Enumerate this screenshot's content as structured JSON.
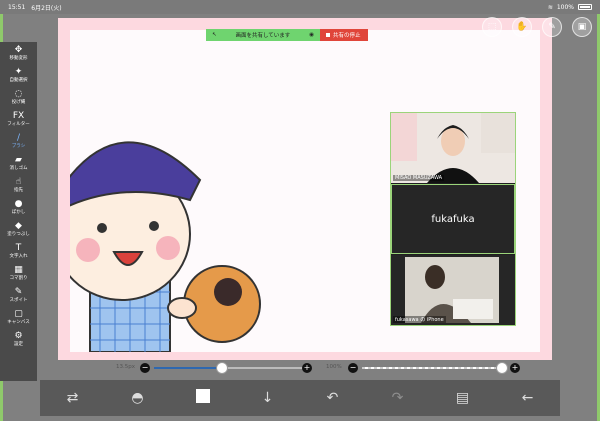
{
  "statusbar": {
    "time": "15:51",
    "date": "6月2日(火)",
    "battery": "100%"
  },
  "share": {
    "sharing_text": "画面を共有しています",
    "stop_text": "共有の停止"
  },
  "tools": [
    {
      "label": "移動変形",
      "icon": "✥"
    },
    {
      "label": "自動選択",
      "icon": "✦"
    },
    {
      "label": "投げ縄",
      "icon": "◌"
    },
    {
      "label": "フィルター",
      "icon": "FX"
    },
    {
      "label": "ブラシ",
      "icon": "/"
    },
    {
      "label": "消しゴム",
      "icon": "▰"
    },
    {
      "label": "指先",
      "icon": "☝"
    },
    {
      "label": "ぼかし",
      "icon": "●"
    },
    {
      "label": "塗りつぶし",
      "icon": "◆"
    },
    {
      "label": "文字入れ",
      "icon": "T"
    },
    {
      "label": "コマ割り",
      "icon": "▦"
    },
    {
      "label": "スポイト",
      "icon": "✎"
    },
    {
      "label": "キャンバス",
      "icon": "▢"
    },
    {
      "label": "設定",
      "icon": "⚙"
    }
  ],
  "active_tool_index": 4,
  "brush_size": "13.5px",
  "brush_size_fraction": 0.45,
  "opacity": "100%",
  "opacity_fraction": 1.0,
  "participants": [
    {
      "name": "MISAO MASUZAWA"
    },
    {
      "name": "fukafuka"
    },
    {
      "name": "fukasawa の iPhone"
    }
  ],
  "colors": {
    "accent": "#2e68b0",
    "share_green": "#6fd46f",
    "share_red": "#e0453a",
    "canvas_border": "#fdd9e0"
  }
}
